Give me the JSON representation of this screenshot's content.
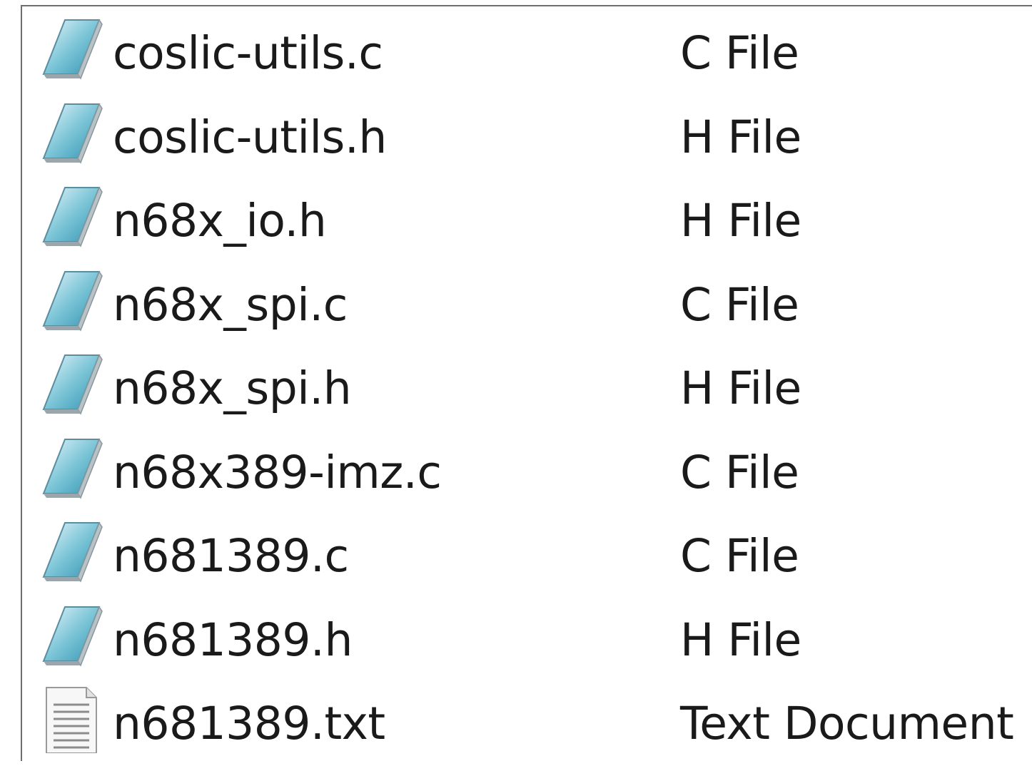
{
  "files": [
    {
      "name": "coslic-utils.c",
      "type": "C File",
      "icon": "c-source-file-icon"
    },
    {
      "name": "coslic-utils.h",
      "type": "H File",
      "icon": "header-file-icon"
    },
    {
      "name": "n68x_io.h",
      "type": "H File",
      "icon": "header-file-icon"
    },
    {
      "name": "n68x_spi.c",
      "type": "C File",
      "icon": "c-source-file-icon"
    },
    {
      "name": "n68x_spi.h",
      "type": "H File",
      "icon": "header-file-icon"
    },
    {
      "name": "n68x389-imz.c",
      "type": "C File",
      "icon": "c-source-file-icon"
    },
    {
      "name": "n681389.c",
      "type": "C File",
      "icon": "c-source-file-icon"
    },
    {
      "name": "n681389.h",
      "type": "H File",
      "icon": "header-file-icon"
    },
    {
      "name": "n681389.txt",
      "type": "Text Document",
      "icon": "text-document-icon"
    }
  ]
}
